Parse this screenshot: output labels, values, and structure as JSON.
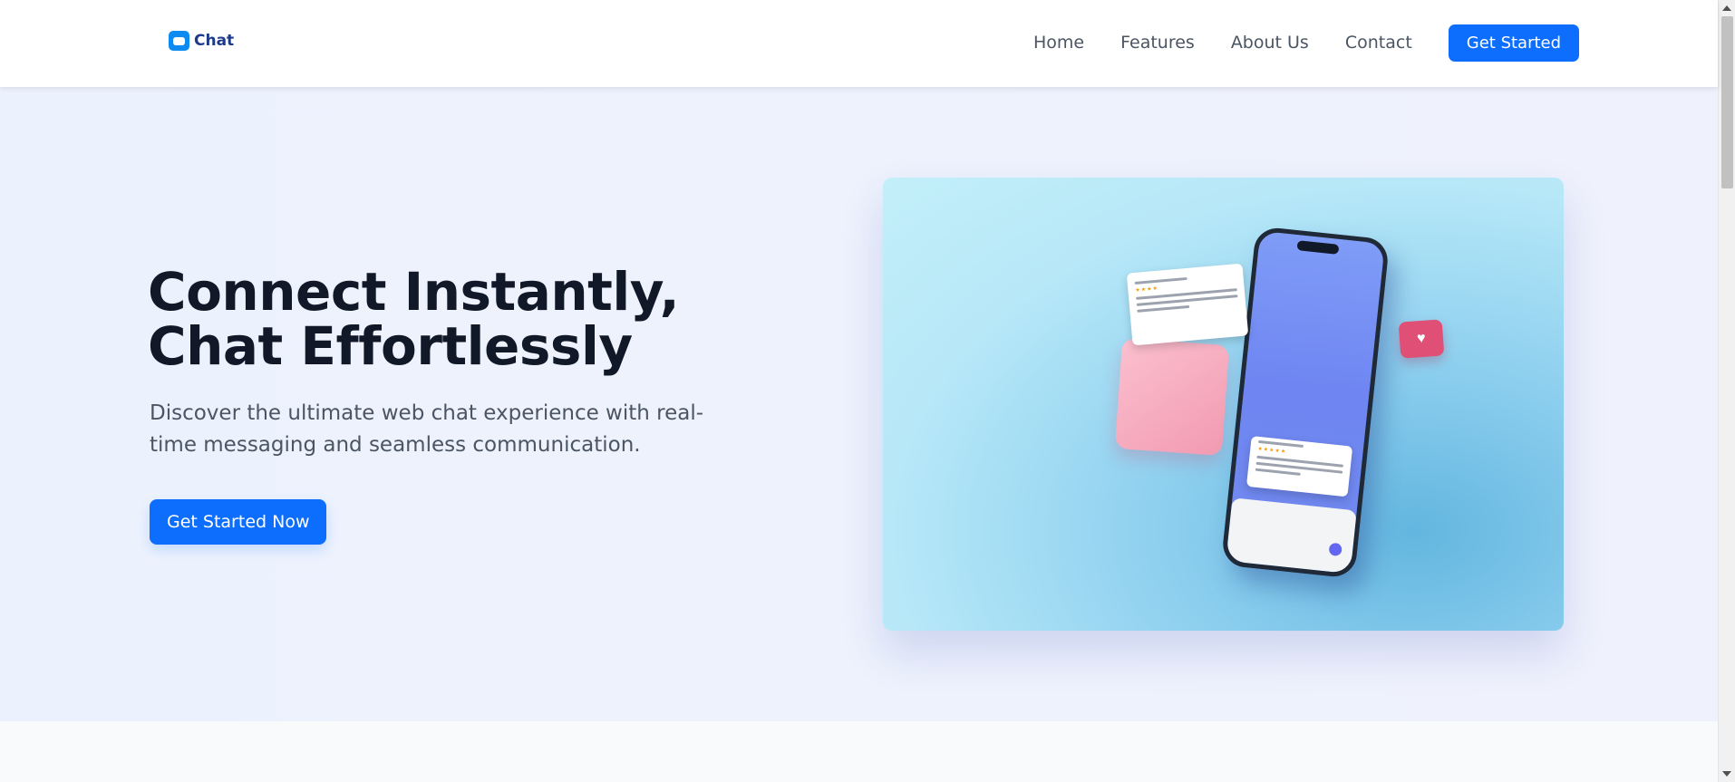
{
  "header": {
    "logo_text": "Chat",
    "logo_icon": "chat-bubble-icon",
    "nav": [
      {
        "label": "Home"
      },
      {
        "label": "Features"
      },
      {
        "label": "About Us"
      },
      {
        "label": "Contact"
      }
    ],
    "cta_label": "Get Started"
  },
  "hero": {
    "title": "Connect Instantly, Chat Effortlessly",
    "subtitle": "Discover the ultimate web chat experience with real-time messaging and seamless communication.",
    "cta_label": "Get Started Now",
    "illustration": "phone-chat-illustration"
  },
  "colors": {
    "primary": "#0d6efd",
    "heading": "#111827",
    "body_text": "#4b5563",
    "hero_bg": "#eef2fd",
    "logo": "#0d8bf0"
  }
}
